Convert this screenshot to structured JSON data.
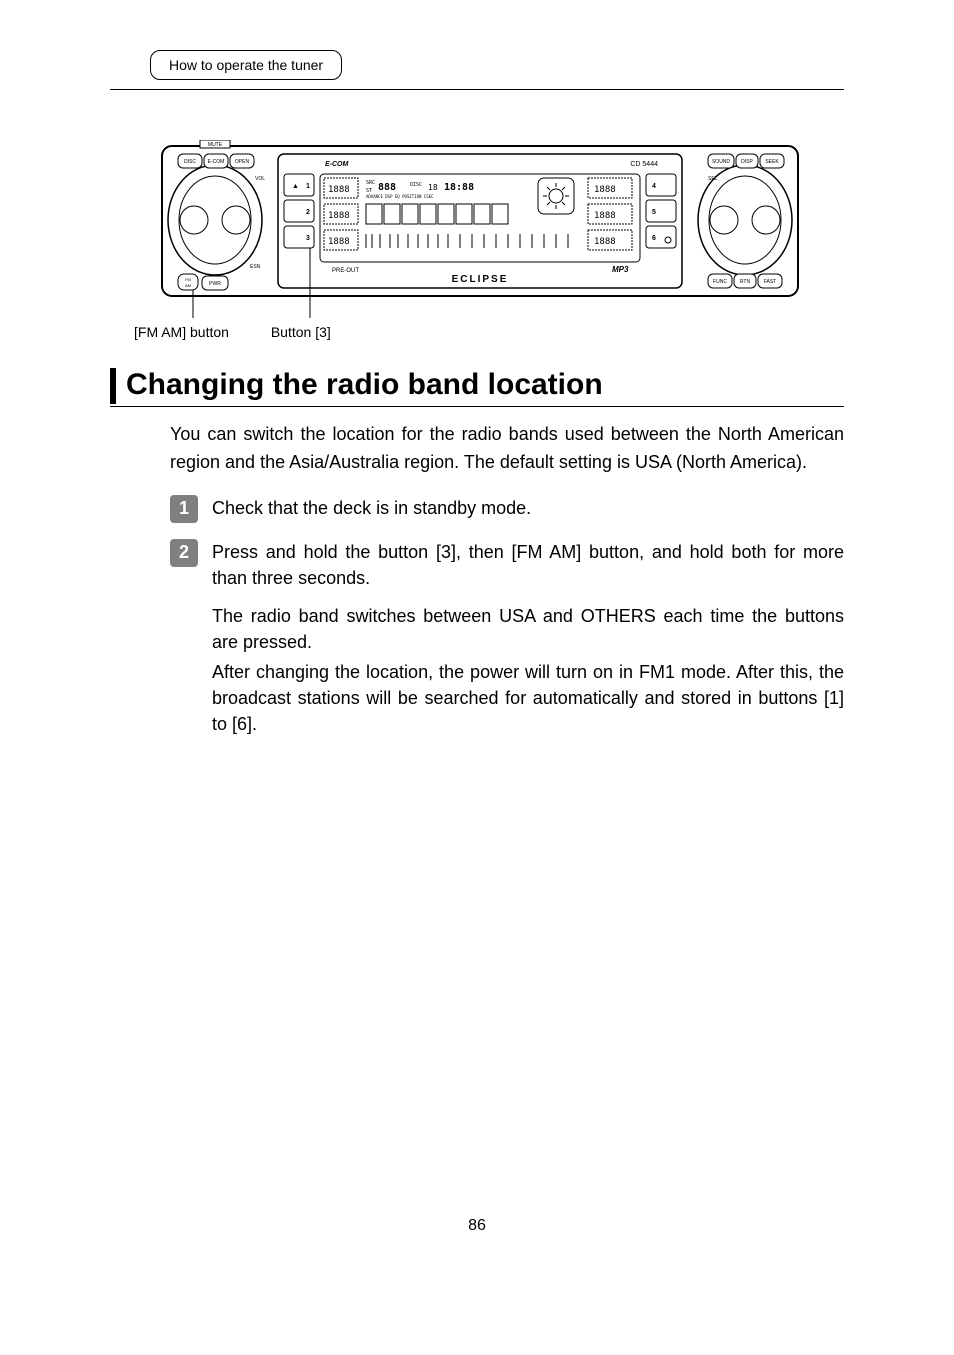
{
  "breadcrumb": "How to operate the tuner",
  "diagram": {
    "label1": "[FM AM] button",
    "label2": "Button [3]",
    "model": "CD 5444",
    "brand_left": "E-COM",
    "brand_bottom": "ECLIPSE",
    "left_buttons": [
      "DISC",
      "E-COM",
      "OPEN"
    ],
    "right_buttons_top": [
      "SOUND",
      "DISP",
      "SEEK"
    ],
    "right_buttons_bottom": [
      "FUNC",
      "RTN",
      "FAST"
    ],
    "left_labels": [
      "MUTE",
      "VOL",
      "ESN"
    ],
    "right_label": "SEL",
    "bottom_left": [
      "FM AM",
      "PWR"
    ],
    "preset_left": [
      "1",
      "2",
      "3"
    ],
    "preset_right": [
      "4",
      "5",
      "6"
    ],
    "below_presets": "PRE-OUT",
    "display_top_text": [
      "SRC",
      "DISC",
      "18:88",
      "ADVANCE DSP EQ POSITION CSEC"
    ],
    "display_numbers": [
      "1888",
      "1888",
      "1888",
      "1888",
      "1888",
      "1888"
    ],
    "mp3": "MP3"
  },
  "heading": "Changing the radio band location",
  "intro": "You can switch the location for the radio bands used between the North American region and the Asia/Australia region. The default setting is USA (North America).",
  "steps": [
    {
      "num": "1",
      "primary": "Check that the deck is in standby mode."
    },
    {
      "num": "2",
      "primary": "Press and hold the button [3], then [FM AM] button, and hold both for more than three seconds.",
      "secondary": "The radio band switches between USA and OTHERS each time the buttons are pressed.",
      "tertiary": "After changing the location, the power will turn on in FM1 mode. After this, the broadcast stations will be searched for automatically and stored in buttons [1] to [6]."
    }
  ],
  "pagenum": "86"
}
